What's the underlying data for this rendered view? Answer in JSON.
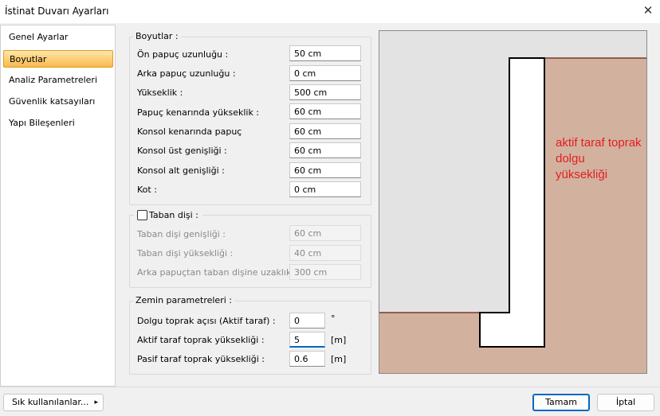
{
  "window": {
    "title": "İstinat Duvarı Ayarları",
    "close_glyph": "✕"
  },
  "nav": {
    "items": [
      {
        "label": "Genel Ayarlar",
        "selected": false
      },
      {
        "label": "Boyutlar",
        "selected": true
      },
      {
        "label": "Analiz Parametreleri",
        "selected": false
      },
      {
        "label": "Güvenlik katsayıları",
        "selected": false
      },
      {
        "label": "Yapı Bileşenleri",
        "selected": false
      }
    ]
  },
  "boyutlar": {
    "title": "Boyutlar :",
    "fields": [
      {
        "label": "Ön papuç uzunluğu :",
        "value": "50 cm"
      },
      {
        "label": "Arka papuç uzunluğu :",
        "value": "0 cm"
      },
      {
        "label": "Yükseklik :",
        "value": "500 cm"
      },
      {
        "label": "Papuç kenarında yükseklik :",
        "value": "60 cm"
      },
      {
        "label": "Konsol kenarında papuç",
        "value": "60 cm"
      },
      {
        "label": "Konsol üst genişliği :",
        "value": "60 cm"
      },
      {
        "label": "Konsol alt genişliği :",
        "value": "60 cm"
      },
      {
        "label": "Kot :",
        "value": "0 cm"
      }
    ]
  },
  "taban_disi": {
    "title": "Taban dişi :",
    "checked": false,
    "fields": [
      {
        "label": "Taban dişi genişliği :",
        "value": "60 cm"
      },
      {
        "label": "Taban dişi yüksekliği :",
        "value": "40 cm"
      },
      {
        "label": "Arka papuçtan taban dişine uzaklık :",
        "value": "300 cm"
      }
    ]
  },
  "zemin": {
    "title": "Zemin parametreleri :",
    "fields": [
      {
        "label": "Dolgu toprak açısı (Aktif taraf) :",
        "value": "0",
        "unit": "°"
      },
      {
        "label": "Aktif taraf toprak yüksekliği :",
        "value": "5",
        "unit": "[m]"
      },
      {
        "label": "Pasif taraf toprak yüksekliği :",
        "value": "0.6",
        "unit": "[m]"
      }
    ]
  },
  "preview": {
    "annotation": "aktif taraf toprak\ndolgu\nyüksekliği",
    "colors": {
      "soil": "#d3b19f",
      "air": "#e3e3e3",
      "wall": "#ffffff",
      "outline": "#000000",
      "surface_line": "#7a3a2a",
      "annotation": "#e02020"
    }
  },
  "footer": {
    "favorites_label": "Sık kullanılanlar...",
    "favorites_arrow": "▸",
    "ok_label": "Tamam",
    "cancel_label": "İptal"
  }
}
